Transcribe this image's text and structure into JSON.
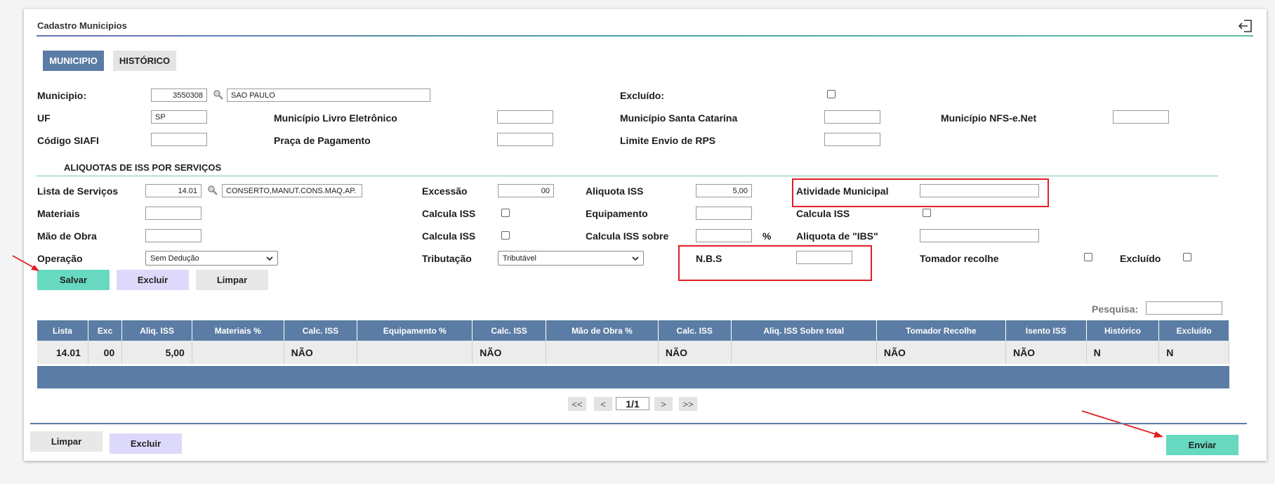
{
  "header": {
    "title": "Cadastro Municipios"
  },
  "tabs": [
    {
      "label": "MUNICIPIO"
    },
    {
      "label": "HISTÓRICO"
    }
  ],
  "municipio": {
    "municipio_label": "Municipio:",
    "municipio_code": "3550308",
    "municipio_name": "SAO PAULO",
    "excluido_label": "Excluído:",
    "uf_label": "UF",
    "uf_value": "SP",
    "livro_label": "Município Livro Eletrônico",
    "santa_catarina_label": "Município Santa Catarina",
    "nfse_label": "Município NFS-e.Net",
    "siafi_label": "Código SIAFI",
    "praca_label": "Praça de Pagamento",
    "limite_label": "Limite Envio de RPS"
  },
  "aliquotas": {
    "section_title": "ALIQUOTAS DE ISS POR SERVIÇOS",
    "lista_label": "Lista de Serviços",
    "lista_code": "14.01",
    "lista_desc": "CONSERTO,MANUT.CONS.MAQ.AP.",
    "excessao_label": "Excessão",
    "excessao_value": "00",
    "aliquota_iss_label": "Aliquota ISS",
    "aliquota_iss_value": "5,00",
    "atividade_label": "Atividade Municipal",
    "materiais_label": "Materiais",
    "calcula_iss_label_1": "Calcula ISS",
    "equipamento_label": "Equipamento",
    "calcula_iss_label_2": "Calcula ISS",
    "mao_obra_label": "Mão de Obra",
    "calcula_iss_label_3": "Calcula ISS",
    "calcula_sobre_label": "Calcula ISS sobre",
    "percent": "%",
    "ibs_label": "Aliquota de \"IBS\"",
    "operacao_label": "Operação",
    "operacao_value": "Sem Dedução",
    "tributacao_label": "Tributação",
    "tributacao_value": "Tributável",
    "nbs_label": "N.B.S",
    "tomador_label": "Tomador recolhe",
    "excluido_label": "Excluído"
  },
  "actions": {
    "salvar": "Salvar",
    "excluir": "Excluir",
    "limpar": "Limpar"
  },
  "search": {
    "label": "Pesquisa:"
  },
  "table": {
    "headers": [
      "Lista",
      "Exc",
      "Aliq. ISS",
      "Materiais %",
      "Calc. ISS",
      "Equipamento %",
      "Calc. ISS",
      "Mão de Obra %",
      "Calc. ISS",
      "Aliq. ISS Sobre total",
      "Tomador Recolhe",
      "Isento ISS",
      "Histórico",
      "Excluído"
    ],
    "rows": [
      [
        "14.01",
        "00",
        "5,00",
        "",
        "NÃO",
        "",
        "NÃO",
        "",
        "NÃO",
        "",
        "NÃO",
        "NÃO",
        "N",
        "N"
      ]
    ]
  },
  "pager": {
    "first": "<<",
    "prev": "<",
    "page": "1/1",
    "next": ">",
    "last": ">>"
  },
  "footer": {
    "limpar": "Limpar",
    "excluir": "Excluir",
    "enviar": "Enviar"
  },
  "colors": {
    "accent": "#5b7ca4",
    "save": "#67d9c0",
    "delete": "#ddd9fb",
    "highlight": "#e31e24"
  }
}
